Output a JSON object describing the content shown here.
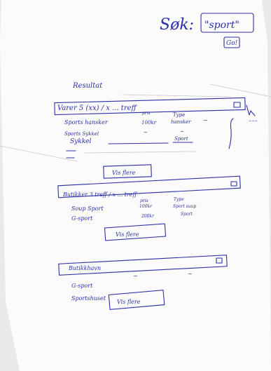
{
  "header": {
    "search_label": "Søk:",
    "search_value": "\"sport\"",
    "go_button": "Go!"
  },
  "results_title": "Resultat",
  "groups": [
    {
      "header": "Varer 5 (xx) / x ... treff",
      "col_headers": [
        "pris",
        "Type"
      ],
      "rows": [
        {
          "name": "Sports hansker",
          "price": "100kr",
          "type": "hansker",
          "extra": "~"
        },
        {
          "name": "Sports Sykkel",
          "price": "~",
          "type": "~",
          "extra": ""
        },
        {
          "name": "Sykkel",
          "price": "",
          "type": "Sport",
          "extra": ""
        }
      ],
      "more_button": "Vis flere"
    },
    {
      "header": "Butikker 3 treff / x ... treff",
      "col_headers": [
        "pris",
        "Type"
      ],
      "rows": [
        {
          "name": "Soup Sport",
          "price": "100kr",
          "type": "Sport suup",
          "extra": ""
        },
        {
          "name": "G-sport",
          "price": "200kr",
          "type": "Sport",
          "extra": ""
        }
      ],
      "more_button": "Vis flere"
    },
    {
      "header": "Butikkhavn",
      "rows": [
        {
          "name": "G-sport",
          "price": "~",
          "type": "~"
        },
        {
          "name": "Sportshuset",
          "price": "",
          "type": ""
        }
      ],
      "more_button": "Vis flere"
    }
  ]
}
